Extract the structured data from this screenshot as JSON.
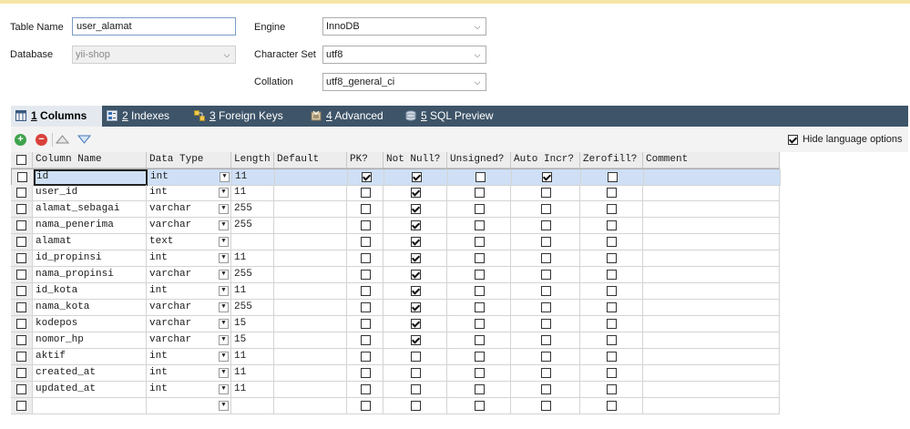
{
  "form": {
    "table_name_label": "Table Name",
    "table_name_value": "user_alamat",
    "database_label": "Database",
    "database_value": "yii-shop",
    "engine_label": "Engine",
    "engine_value": "InnoDB",
    "charset_label": "Character Set",
    "charset_value": "utf8",
    "collation_label": "Collation",
    "collation_value": "utf8_general_ci"
  },
  "tabs": [
    {
      "num": "1",
      "label": " Columns"
    },
    {
      "num": "2",
      "label": " Indexes"
    },
    {
      "num": "3",
      "label": " Foreign Keys"
    },
    {
      "num": "4",
      "label": " Advanced"
    },
    {
      "num": "5",
      "label": " SQL Preview"
    }
  ],
  "toolbar": {
    "hide_language_label": "Hide language options",
    "hide_language_checked": true
  },
  "columns": {
    "headers": [
      "Column Name",
      "Data Type",
      "Length",
      "Default",
      "PK?",
      "Not Null?",
      "Unsigned?",
      "Auto Incr?",
      "Zerofill?",
      "Comment"
    ],
    "rows": [
      {
        "name": "id",
        "type": "int",
        "length": "11",
        "default": "",
        "pk": true,
        "notnull": true,
        "unsigned": false,
        "autoincr": true,
        "zerofill": false,
        "comment": ""
      },
      {
        "name": "user_id",
        "type": "int",
        "length": "11",
        "default": "",
        "pk": false,
        "notnull": true,
        "unsigned": false,
        "autoincr": false,
        "zerofill": false,
        "comment": ""
      },
      {
        "name": "alamat_sebagai",
        "type": "varchar",
        "length": "255",
        "default": "",
        "pk": false,
        "notnull": true,
        "unsigned": false,
        "autoincr": false,
        "zerofill": false,
        "comment": ""
      },
      {
        "name": "nama_penerima",
        "type": "varchar",
        "length": "255",
        "default": "",
        "pk": false,
        "notnull": true,
        "unsigned": false,
        "autoincr": false,
        "zerofill": false,
        "comment": ""
      },
      {
        "name": "alamat",
        "type": "text",
        "length": "",
        "default": "",
        "pk": false,
        "notnull": true,
        "unsigned": false,
        "autoincr": false,
        "zerofill": false,
        "comment": ""
      },
      {
        "name": "id_propinsi",
        "type": "int",
        "length": "11",
        "default": "",
        "pk": false,
        "notnull": true,
        "unsigned": false,
        "autoincr": false,
        "zerofill": false,
        "comment": ""
      },
      {
        "name": "nama_propinsi",
        "type": "varchar",
        "length": "255",
        "default": "",
        "pk": false,
        "notnull": true,
        "unsigned": false,
        "autoincr": false,
        "zerofill": false,
        "comment": ""
      },
      {
        "name": "id_kota",
        "type": "int",
        "length": "11",
        "default": "",
        "pk": false,
        "notnull": true,
        "unsigned": false,
        "autoincr": false,
        "zerofill": false,
        "comment": ""
      },
      {
        "name": "nama_kota",
        "type": "varchar",
        "length": "255",
        "default": "",
        "pk": false,
        "notnull": true,
        "unsigned": false,
        "autoincr": false,
        "zerofill": false,
        "comment": ""
      },
      {
        "name": "kodepos",
        "type": "varchar",
        "length": "15",
        "default": "",
        "pk": false,
        "notnull": true,
        "unsigned": false,
        "autoincr": false,
        "zerofill": false,
        "comment": ""
      },
      {
        "name": "nomor_hp",
        "type": "varchar",
        "length": "15",
        "default": "",
        "pk": false,
        "notnull": true,
        "unsigned": false,
        "autoincr": false,
        "zerofill": false,
        "comment": ""
      },
      {
        "name": "aktif",
        "type": "int",
        "length": "11",
        "default": "",
        "pk": false,
        "notnull": false,
        "unsigned": false,
        "autoincr": false,
        "zerofill": false,
        "comment": ""
      },
      {
        "name": "created_at",
        "type": "int",
        "length": "11",
        "default": "",
        "pk": false,
        "notnull": false,
        "unsigned": false,
        "autoincr": false,
        "zerofill": false,
        "comment": ""
      },
      {
        "name": "updated_at",
        "type": "int",
        "length": "11",
        "default": "",
        "pk": false,
        "notnull": false,
        "unsigned": false,
        "autoincr": false,
        "zerofill": false,
        "comment": ""
      },
      {
        "name": "",
        "type": "",
        "length": "",
        "default": "",
        "pk": false,
        "notnull": false,
        "unsigned": false,
        "autoincr": false,
        "zerofill": false,
        "comment": ""
      }
    ]
  },
  "icons": {
    "add": "add-circle-icon",
    "remove": "remove-circle-icon",
    "up": "move-up-icon",
    "down": "move-down-icon"
  },
  "colors": {
    "tab_bar": "#3e5468",
    "selected_row": "#cfe0f6",
    "add_green": "#3fa34d",
    "remove_red": "#d9413b"
  }
}
